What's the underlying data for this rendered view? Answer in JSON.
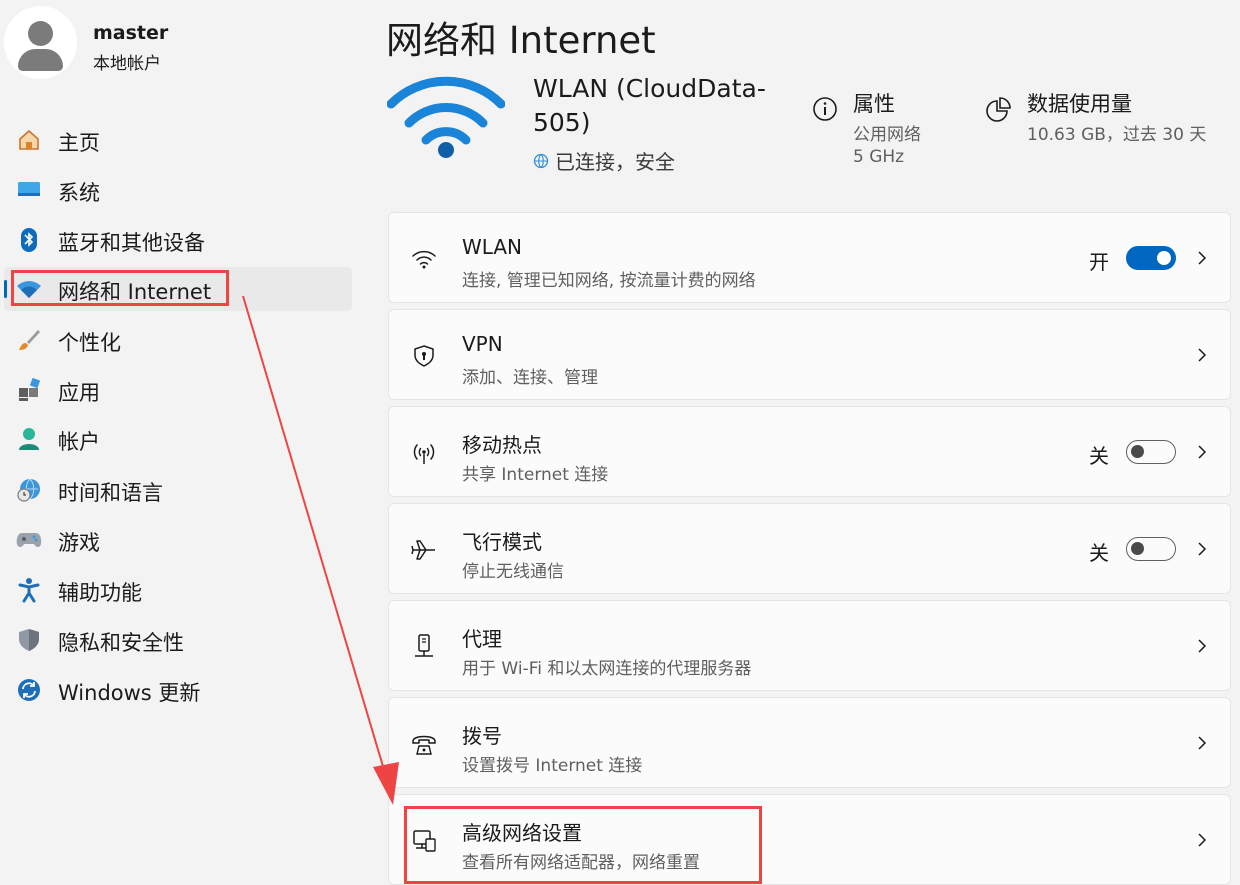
{
  "user": {
    "name": "master",
    "account_type": "本地帐户"
  },
  "sidebar": {
    "selected_index": 3,
    "items": [
      {
        "label": "主页",
        "icon": "home-icon"
      },
      {
        "label": "系统",
        "icon": "system-icon"
      },
      {
        "label": "蓝牙和其他设备",
        "icon": "bluetooth-icon"
      },
      {
        "label": "网络和 Internet",
        "icon": "wifi-icon"
      },
      {
        "label": "个性化",
        "icon": "brush-icon"
      },
      {
        "label": "应用",
        "icon": "apps-icon"
      },
      {
        "label": "帐户",
        "icon": "account-icon"
      },
      {
        "label": "时间和语言",
        "icon": "globe-clock-icon"
      },
      {
        "label": "游戏",
        "icon": "gamepad-icon"
      },
      {
        "label": "辅助功能",
        "icon": "accessibility-icon"
      },
      {
        "label": "隐私和安全性",
        "icon": "shield-icon"
      },
      {
        "label": "Windows 更新",
        "icon": "update-icon"
      }
    ]
  },
  "header": {
    "title": "网络和 Internet",
    "network_name": "WLAN (CloudData-505)",
    "network_status": "已连接，安全",
    "properties": {
      "title": "属性",
      "line1": "公用网络",
      "line2": "5 GHz"
    },
    "data_usage": {
      "title": "数据使用量",
      "line1": "10.63 GB，过去 30 天"
    }
  },
  "cards": [
    {
      "title": "WLAN",
      "subtitle": "连接, 管理已知网络, 按流量计费的网络",
      "icon": "wifi-icon",
      "toggle_label": "开",
      "toggle_state": "on"
    },
    {
      "title": "VPN",
      "subtitle": "添加、连接、管理",
      "icon": "vpn-shield-icon"
    },
    {
      "title": "移动热点",
      "subtitle": "共享 Internet 连接",
      "icon": "hotspot-icon",
      "toggle_label": "关",
      "toggle_state": "off"
    },
    {
      "title": "飞行模式",
      "subtitle": "停止无线通信",
      "icon": "airplane-icon",
      "toggle_label": "关",
      "toggle_state": "off"
    },
    {
      "title": "代理",
      "subtitle": "用于 Wi-Fi 和以太网连接的代理服务器",
      "icon": "proxy-icon"
    },
    {
      "title": "拨号",
      "subtitle": "设置拨号 Internet 连接",
      "icon": "dialup-icon"
    },
    {
      "title": "高级网络设置",
      "subtitle": "查看所有网络适配器，网络重置",
      "icon": "network-adapter-icon"
    }
  ],
  "colors": {
    "accent": "#0067c0",
    "highlight": "#ee4444",
    "background": "#f3f3f3",
    "card": "#fbfbfb"
  }
}
